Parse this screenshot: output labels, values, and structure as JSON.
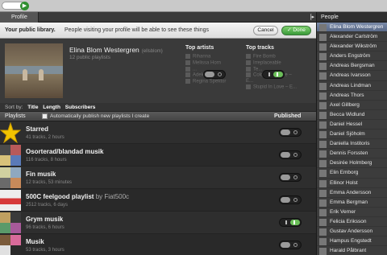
{
  "app": {
    "go_icon": "arrow-right-icon"
  },
  "tabs": {
    "profile": "Profile",
    "collapse_icon": "[▸"
  },
  "banner": {
    "title": "Your public library.",
    "message": "People visiting your profile will be able to see these things",
    "cancel": "Cancel",
    "done": "✓ Done"
  },
  "profile": {
    "name": "Elina Blom Westergren",
    "nickname": "(ellsblom)",
    "subtitle": "12 public playlists",
    "top_artists_label": "Top artists",
    "top_tracks_label": "Top tracks",
    "top_artists": [
      "Rihanna",
      "Melissa Horn",
      "...",
      "Adele",
      "Regina Spektor"
    ],
    "top_tracks": [
      "Fire Bomb",
      "Irreplaceable",
      "Te...",
      "Cold Case Love – E...",
      "Stupid In Love – E..."
    ],
    "artists_published": false,
    "tracks_published": true
  },
  "sortbar": {
    "label": "Sort by:",
    "title": "Title",
    "length": "Length",
    "subscribers": "Subscribers"
  },
  "playlists_header": {
    "label": "Playlists",
    "auto_publish": "Automatically publish new playlists I create",
    "published": "Published"
  },
  "playlists": [
    {
      "name": "Starred",
      "by": "",
      "meta": "41 tracks, 2 hours",
      "published": false,
      "cover": "star-icon"
    },
    {
      "name": "Osorterad/blandad musik",
      "by": "",
      "meta": "116 tracks, 8 hours",
      "published": false,
      "cover": "album-mosaic"
    },
    {
      "name": "Fin musik",
      "by": "",
      "meta": "12 tracks, 53 minutes",
      "published": false,
      "cover": "album-mosaic"
    },
    {
      "name": "500C feelgood playlist",
      "by": "by Fiat500c",
      "meta": "2512 tracks, 6 days",
      "published": false,
      "cover": "playlist-cover"
    },
    {
      "name": "Grym musik",
      "by": "",
      "meta": "96 tracks, 6 hours",
      "published": true,
      "cover": "album-mosaic"
    },
    {
      "name": "Musik",
      "by": "",
      "meta": "53 tracks, 3 hours",
      "published": false,
      "cover": "album-mosaic"
    }
  ],
  "people": {
    "header": "People",
    "list": [
      "Elina Blom Westergren",
      "Alexander Carlström",
      "Alexander Wikström",
      "Anders Engström",
      "Andreas Bergsman",
      "Andreas Ivarsson",
      "Andreas Lindman",
      "Andreas Thors",
      "Axel Gillberg",
      "Becca Widlund",
      "Daniel Hessel",
      "Daniel Sjöholm",
      "Daniella Institoris",
      "Dennis Forssten",
      "Desirée Holmberg",
      "Elin Emborg",
      "Ellinor Holst",
      "Emma Andersson",
      "Emma Bergman",
      "Erik Verner",
      "Felicia Eriksson",
      "Gustav Andersson",
      "Hampus Engstedt",
      "Harald Pålbrant"
    ]
  }
}
